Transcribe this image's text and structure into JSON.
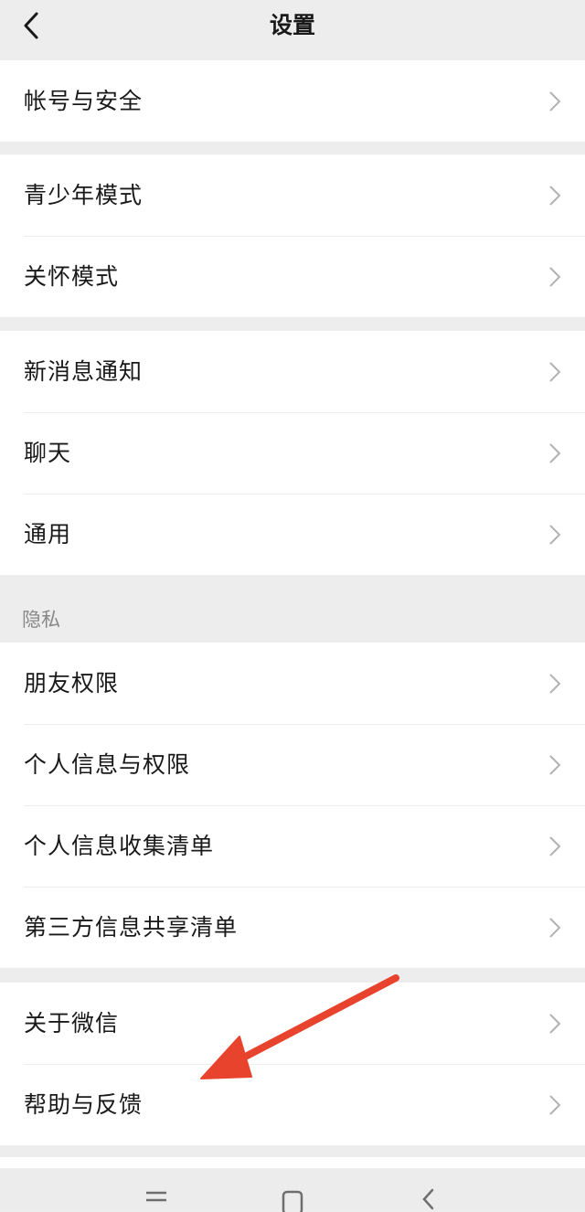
{
  "header": {
    "title": "设置"
  },
  "groups": [
    {
      "items": [
        {
          "label": "帐号与安全"
        }
      ]
    },
    {
      "items": [
        {
          "label": "青少年模式"
        },
        {
          "label": "关怀模式"
        }
      ]
    },
    {
      "items": [
        {
          "label": "新消息通知"
        },
        {
          "label": "聊天"
        },
        {
          "label": "通用"
        }
      ]
    },
    {
      "section_title": "隐私",
      "items": [
        {
          "label": "朋友权限"
        },
        {
          "label": "个人信息与权限"
        },
        {
          "label": "个人信息收集清单"
        },
        {
          "label": "第三方信息共享清单"
        }
      ]
    },
    {
      "items": [
        {
          "label": "关于微信"
        },
        {
          "label": "帮助与反馈"
        }
      ]
    }
  ],
  "annotation": {
    "arrow_color": "#e8432d",
    "points_to": "帮助与反馈"
  },
  "nav": {
    "icons": [
      "menu-icon",
      "home-square-icon",
      "back-icon"
    ]
  }
}
